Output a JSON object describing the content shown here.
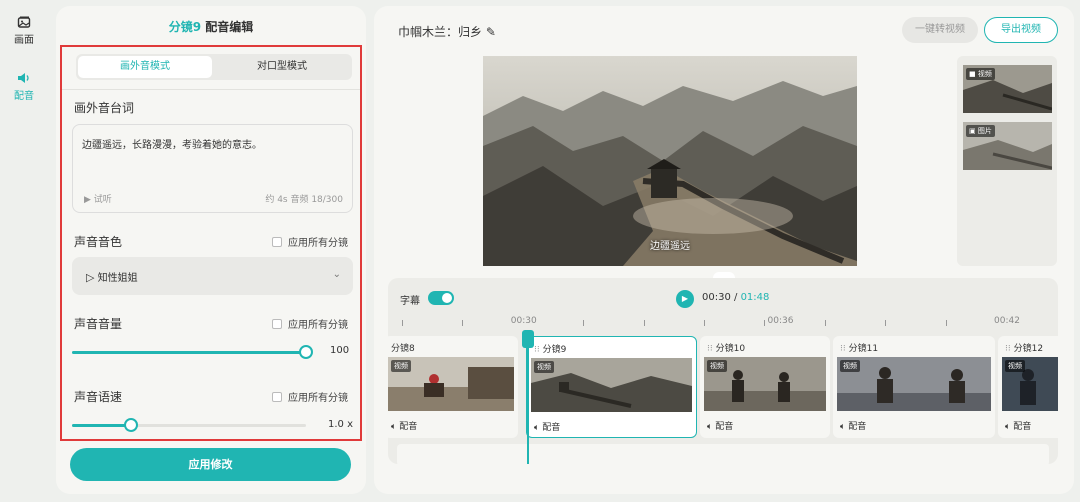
{
  "rail": {
    "items": [
      {
        "label": "画面",
        "icon": "image-icon"
      },
      {
        "label": "配音",
        "icon": "speaker-icon"
      }
    ]
  },
  "editor": {
    "shot": "分镜9",
    "title": "配音编辑",
    "tabs": [
      {
        "label": "画外音模式",
        "active": true
      },
      {
        "label": "对口型模式",
        "active": false
      }
    ],
    "voiceover_label": "画外音台词",
    "voiceover_text": "边疆遥远，长路漫漫，考验着她的意志。",
    "preview_label": "试听",
    "meta": "约 4s 音频 18/300",
    "timbre_label": "声音音色",
    "timbre_value": "知性姐姐",
    "volume_label": "声音音量",
    "volume_value": "100",
    "volume_fraction": 1.0,
    "speed_label": "声音语速",
    "speed_value": "1.0 x",
    "speed_fraction": 0.25,
    "apply_all": "应用所有分镜",
    "apply_button": "应用修改"
  },
  "main": {
    "title": "巾帼木兰：归乡",
    "convert_button": "一键转视频",
    "export_button": "导出视频",
    "subtitle": "边疆遥远",
    "thumbs": [
      {
        "tag": "视频"
      },
      {
        "tag": "图片"
      }
    ]
  },
  "timeline": {
    "caption_label": "字幕",
    "current": "00:30",
    "separator": " / ",
    "total": "01:48",
    "ticks": [
      "00:30",
      "00:36",
      "00:42"
    ],
    "clips": [
      {
        "name": "分镜8",
        "audio": "配音",
        "tag": "视频"
      },
      {
        "name": "分镜9",
        "audio": "配音",
        "tag": "视频"
      },
      {
        "name": "分镜10",
        "audio": "配音",
        "tag": "视频"
      },
      {
        "name": "分镜11",
        "audio": "配音",
        "tag": "视频"
      },
      {
        "name": "分镜12",
        "audio": "配音",
        "tag": "视频"
      }
    ]
  },
  "colors": {
    "accent": "#20b5b2",
    "highlight_box": "#e03a3a"
  }
}
